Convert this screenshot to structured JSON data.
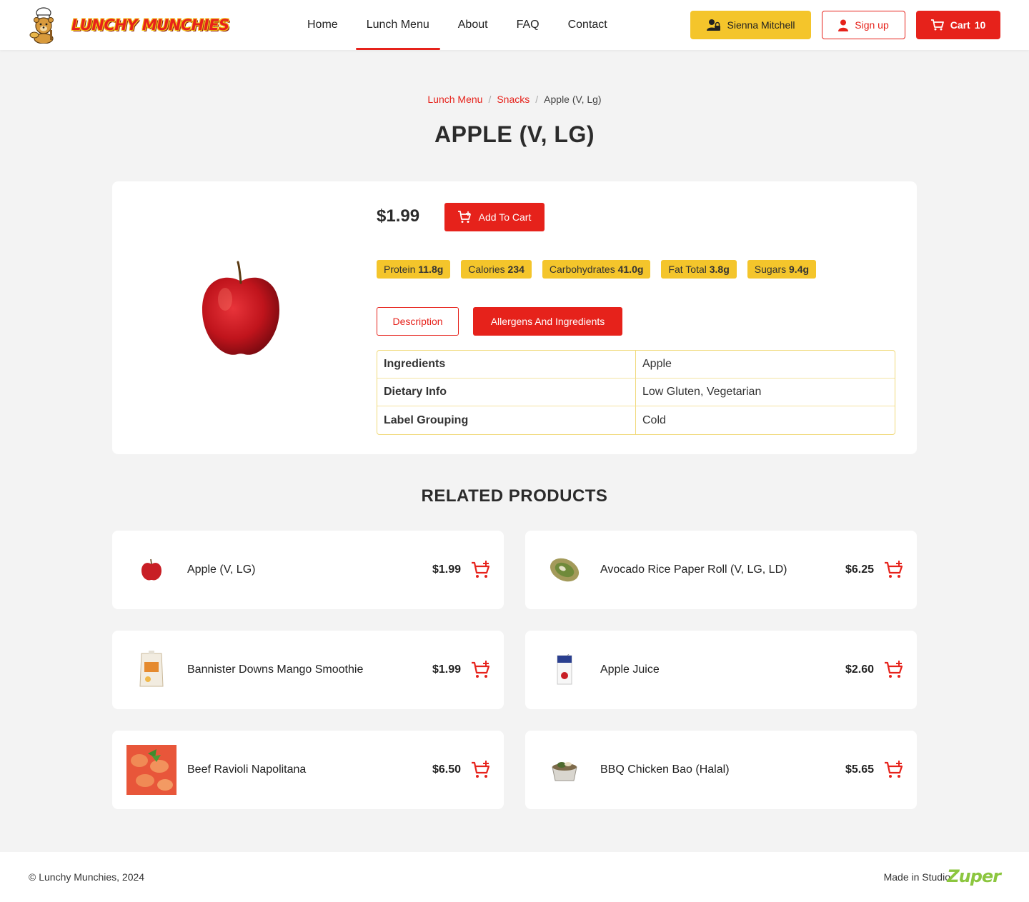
{
  "brand": {
    "name": "LUNCHY MUNCHIES"
  },
  "nav": [
    {
      "label": "Home"
    },
    {
      "label": "Lunch Menu"
    },
    {
      "label": "About"
    },
    {
      "label": "FAQ"
    },
    {
      "label": "Contact"
    }
  ],
  "header": {
    "user_name": "Sienna Mitchell",
    "signup_label": "Sign up",
    "cart_label": "Cart",
    "cart_count": "10"
  },
  "breadcrumb": [
    {
      "label": "Lunch Menu"
    },
    {
      "label": "Snacks"
    },
    {
      "label": "Apple (V, Lg)"
    }
  ],
  "product": {
    "title": "APPLE (V, LG)",
    "price": "$1.99",
    "add_to_cart_label": "Add To Cart",
    "nutrients": [
      {
        "label": "Protein",
        "value": "11.8g"
      },
      {
        "label": "Calories",
        "value": "234"
      },
      {
        "label": "Carbohydrates",
        "value": "41.0g"
      },
      {
        "label": "Fat Total",
        "value": "3.8g"
      },
      {
        "label": "Sugars",
        "value": "9.4g"
      }
    ],
    "tabs": {
      "description": "Description",
      "allergens": "Allergens And Ingredients"
    },
    "details": [
      {
        "key": "Ingredients",
        "value": "Apple"
      },
      {
        "key": "Dietary Info",
        "value": "Low Gluten, Vegetarian"
      },
      {
        "key": "Label Grouping",
        "value": "Cold"
      }
    ]
  },
  "related": {
    "title": "RELATED PRODUCTS",
    "items": [
      {
        "name": "Apple (V, LG)",
        "price": "$1.99"
      },
      {
        "name": "Avocado Rice Paper Roll (V, LG, LD)",
        "price": "$6.25"
      },
      {
        "name": "Bannister Downs Mango Smoothie",
        "price": "$1.99"
      },
      {
        "name": "Apple Juice",
        "price": "$2.60"
      },
      {
        "name": "Beef Ravioli Napolitana",
        "price": "$6.50"
      },
      {
        "name": "BBQ Chicken Bao (Halal)",
        "price": "$5.65"
      }
    ]
  },
  "footer": {
    "copyright": "© Lunchy Munchies, 2024",
    "made_in": "Made in Studio",
    "studio_logo": "Zuper"
  },
  "colors": {
    "accent": "#e6221b",
    "yellow": "#f4c52b",
    "green": "#8cc63f"
  }
}
